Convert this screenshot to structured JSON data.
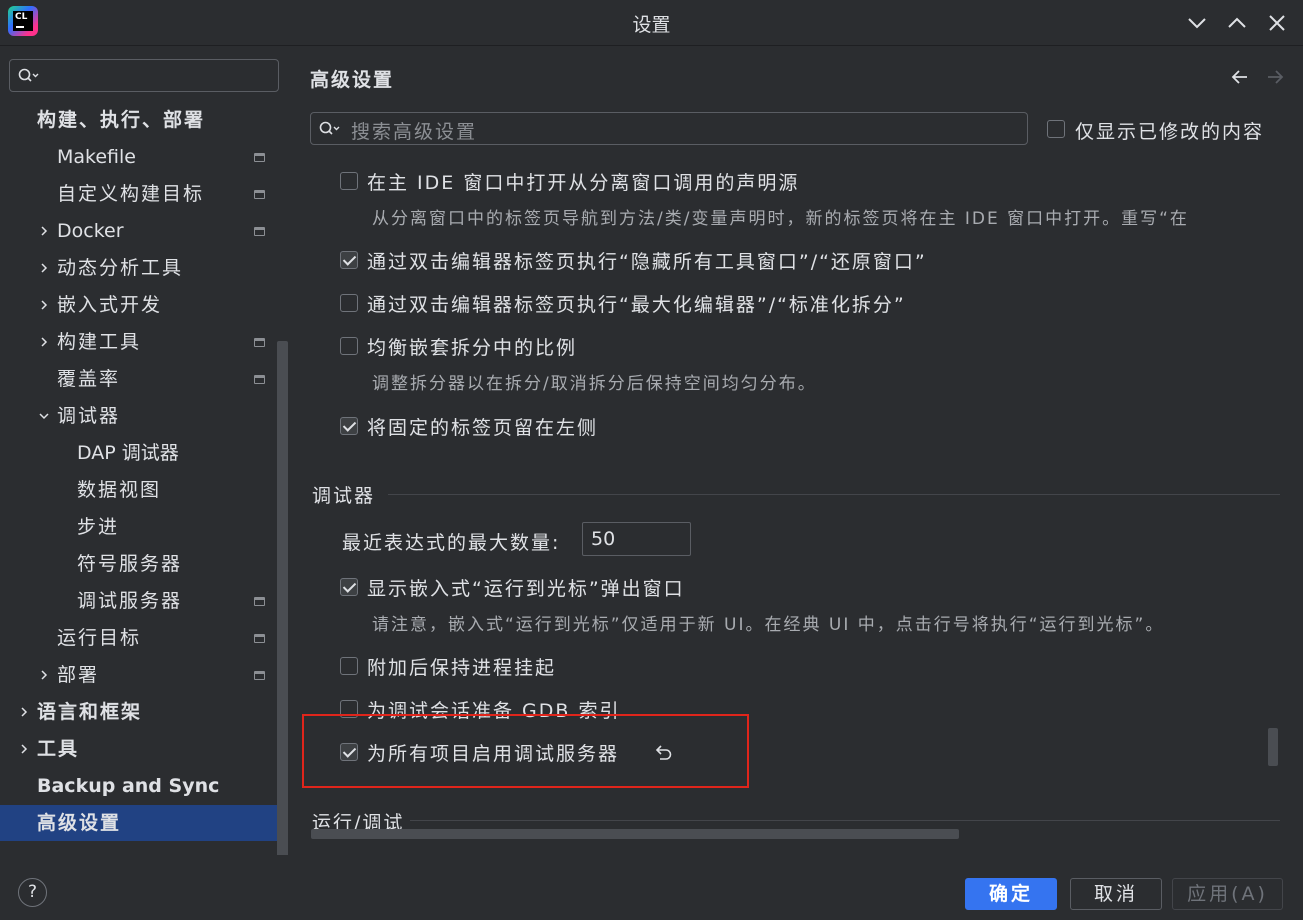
{
  "window": {
    "title": "设置",
    "logo_text": "CL"
  },
  "sidebar": {
    "search_placeholder": "",
    "items": [
      {
        "label": "构建、执行、部署",
        "level": 0,
        "bold": true,
        "chevron": "none",
        "project_icon": false
      },
      {
        "label": "Makefile",
        "level": 1,
        "chevron": "none",
        "project_icon": true
      },
      {
        "label": "自定义构建目标",
        "level": 1,
        "chevron": "none",
        "project_icon": true
      },
      {
        "label": "Docker",
        "level": 1,
        "chevron": "right",
        "project_icon": true
      },
      {
        "label": "动态分析工具",
        "level": 1,
        "chevron": "right",
        "project_icon": false
      },
      {
        "label": "嵌入式开发",
        "level": 1,
        "chevron": "right",
        "project_icon": false
      },
      {
        "label": "构建工具",
        "level": 1,
        "chevron": "right",
        "project_icon": true
      },
      {
        "label": "覆盖率",
        "level": 1,
        "chevron": "none",
        "project_icon": true
      },
      {
        "label": "调试器",
        "level": 1,
        "chevron": "down",
        "project_icon": false
      },
      {
        "label": "DAP 调试器",
        "level": 2,
        "chevron": "none",
        "project_icon": false
      },
      {
        "label": "数据视图",
        "level": 2,
        "chevron": "none",
        "project_icon": false
      },
      {
        "label": "步进",
        "level": 2,
        "chevron": "none",
        "project_icon": false
      },
      {
        "label": "符号服务器",
        "level": 2,
        "chevron": "none",
        "project_icon": false
      },
      {
        "label": "调试服务器",
        "level": 2,
        "chevron": "none",
        "project_icon": true
      },
      {
        "label": "运行目标",
        "level": 1,
        "chevron": "none",
        "project_icon": true
      },
      {
        "label": "部署",
        "level": 1,
        "chevron": "right",
        "project_icon": true
      },
      {
        "label": "语言和框架",
        "level": 0,
        "bold": true,
        "chevron": "right",
        "project_icon": false
      },
      {
        "label": "工具",
        "level": 0,
        "bold": true,
        "chevron": "right",
        "project_icon": false
      },
      {
        "label": "Backup and Sync",
        "level": 0,
        "bold": true,
        "chevron": "none",
        "project_icon": false
      },
      {
        "label": "高级设置",
        "level": 0,
        "bold": true,
        "chevron": "none",
        "project_icon": false,
        "selected": true
      }
    ]
  },
  "main": {
    "title": "高级设置",
    "search_placeholder": "搜索高级设置",
    "only_modified_label": "仅显示已修改的内容",
    "options_top": [
      {
        "label": "在主 IDE 窗口中打开从分离窗口调用的声明源",
        "checked": false,
        "desc": "从分离窗口中的标签页导航到方法/类/变量声明时，新的标签页将在主 IDE 窗口中打开。重写“在"
      },
      {
        "label": "通过双击编辑器标签页执行“隐藏所有工具窗口”/“还原窗口”",
        "checked": true
      },
      {
        "label": "通过双击编辑器标签页执行“最大化编辑器”/“标准化拆分”",
        "checked": false
      },
      {
        "label": "均衡嵌套拆分中的比例",
        "checked": false,
        "desc": "调整拆分器以在拆分/取消拆分后保持空间均匀分布。"
      },
      {
        "label": "将固定的标签页留在左侧",
        "checked": true
      }
    ],
    "debugger_section": {
      "title": "调试器",
      "max_expr_label": "最近表达式的最大数量:",
      "max_expr_value": "50",
      "options": [
        {
          "label": "显示嵌入式“运行到光标”弹出窗口",
          "checked": true,
          "desc": "请注意，嵌入式“运行到光标”仅适用于新 UI。在经典 UI 中，点击行号将执行“运行到光标”。"
        },
        {
          "label": "附加后保持进程挂起",
          "checked": false
        },
        {
          "label": "为调试会话准备 GDB 索引",
          "checked": false
        },
        {
          "label": "为所有项目启用调试服务器",
          "checked": true,
          "modified": true
        }
      ]
    },
    "run_debug_section": {
      "title": "运行/调试"
    }
  },
  "footer": {
    "help_label": "?",
    "ok_label": "确定",
    "cancel_label": "取消",
    "apply_label": "应用(A)"
  },
  "colors": {
    "background": "#2b2d30",
    "selection": "#2e436e",
    "primary_button": "#3574f0",
    "highlight_border": "#e0251b"
  }
}
